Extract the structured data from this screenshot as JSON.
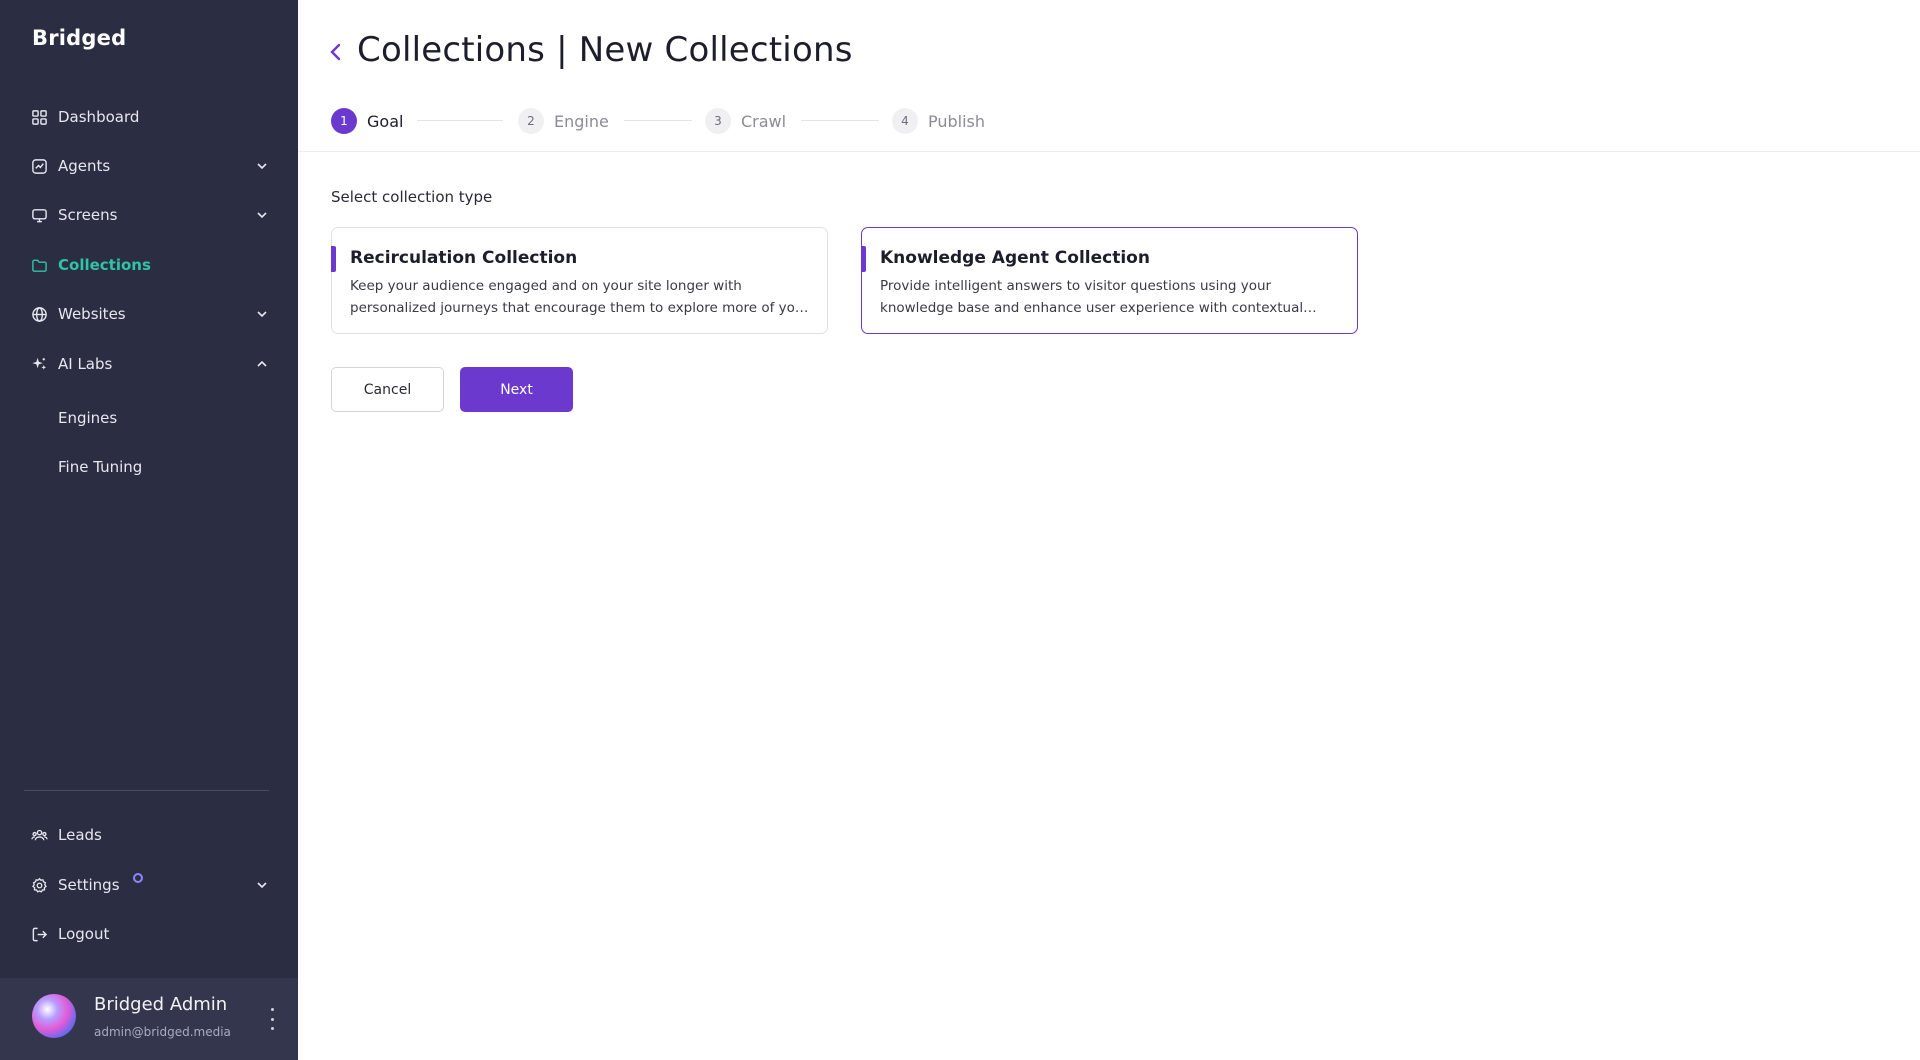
{
  "app": {
    "logo": "Bridged"
  },
  "sidebar": {
    "items": [
      {
        "label": "Dashboard"
      },
      {
        "label": "Agents"
      },
      {
        "label": "Screens"
      },
      {
        "label": "Collections"
      },
      {
        "label": "Websites"
      },
      {
        "label": "AI Labs"
      }
    ],
    "sub_items": [
      {
        "label": "Engines"
      },
      {
        "label": "Fine Tuning"
      }
    ],
    "bottom_items": [
      {
        "label": "Leads"
      },
      {
        "label": "Settings"
      },
      {
        "label": "Logout"
      }
    ],
    "user": {
      "name": "Bridged Admin",
      "email": "admin@bridged.media"
    }
  },
  "header": {
    "title": "Collections | New Collections"
  },
  "stepper": {
    "steps": [
      {
        "num": "1",
        "label": "Goal"
      },
      {
        "num": "2",
        "label": "Engine"
      },
      {
        "num": "3",
        "label": "Crawl"
      },
      {
        "num": "4",
        "label": "Publish"
      }
    ]
  },
  "main": {
    "section_label": "Select collection type",
    "cards": [
      {
        "title": "Recirculation Collection",
        "description": "Keep your audience engaged and on your site longer with personalized journeys that encourage them to explore more of your content"
      },
      {
        "title": "Knowledge Agent Collection",
        "description": "Provide intelligent answers to visitor questions using your knowledge base and enhance user experience with contextual assistance"
      }
    ],
    "buttons": {
      "cancel": "Cancel",
      "next": "Next"
    }
  },
  "theme": {
    "accent": "#6c39cf",
    "active_nav": "#2ec4a5",
    "sidebar_bg": "#2b2d42"
  }
}
